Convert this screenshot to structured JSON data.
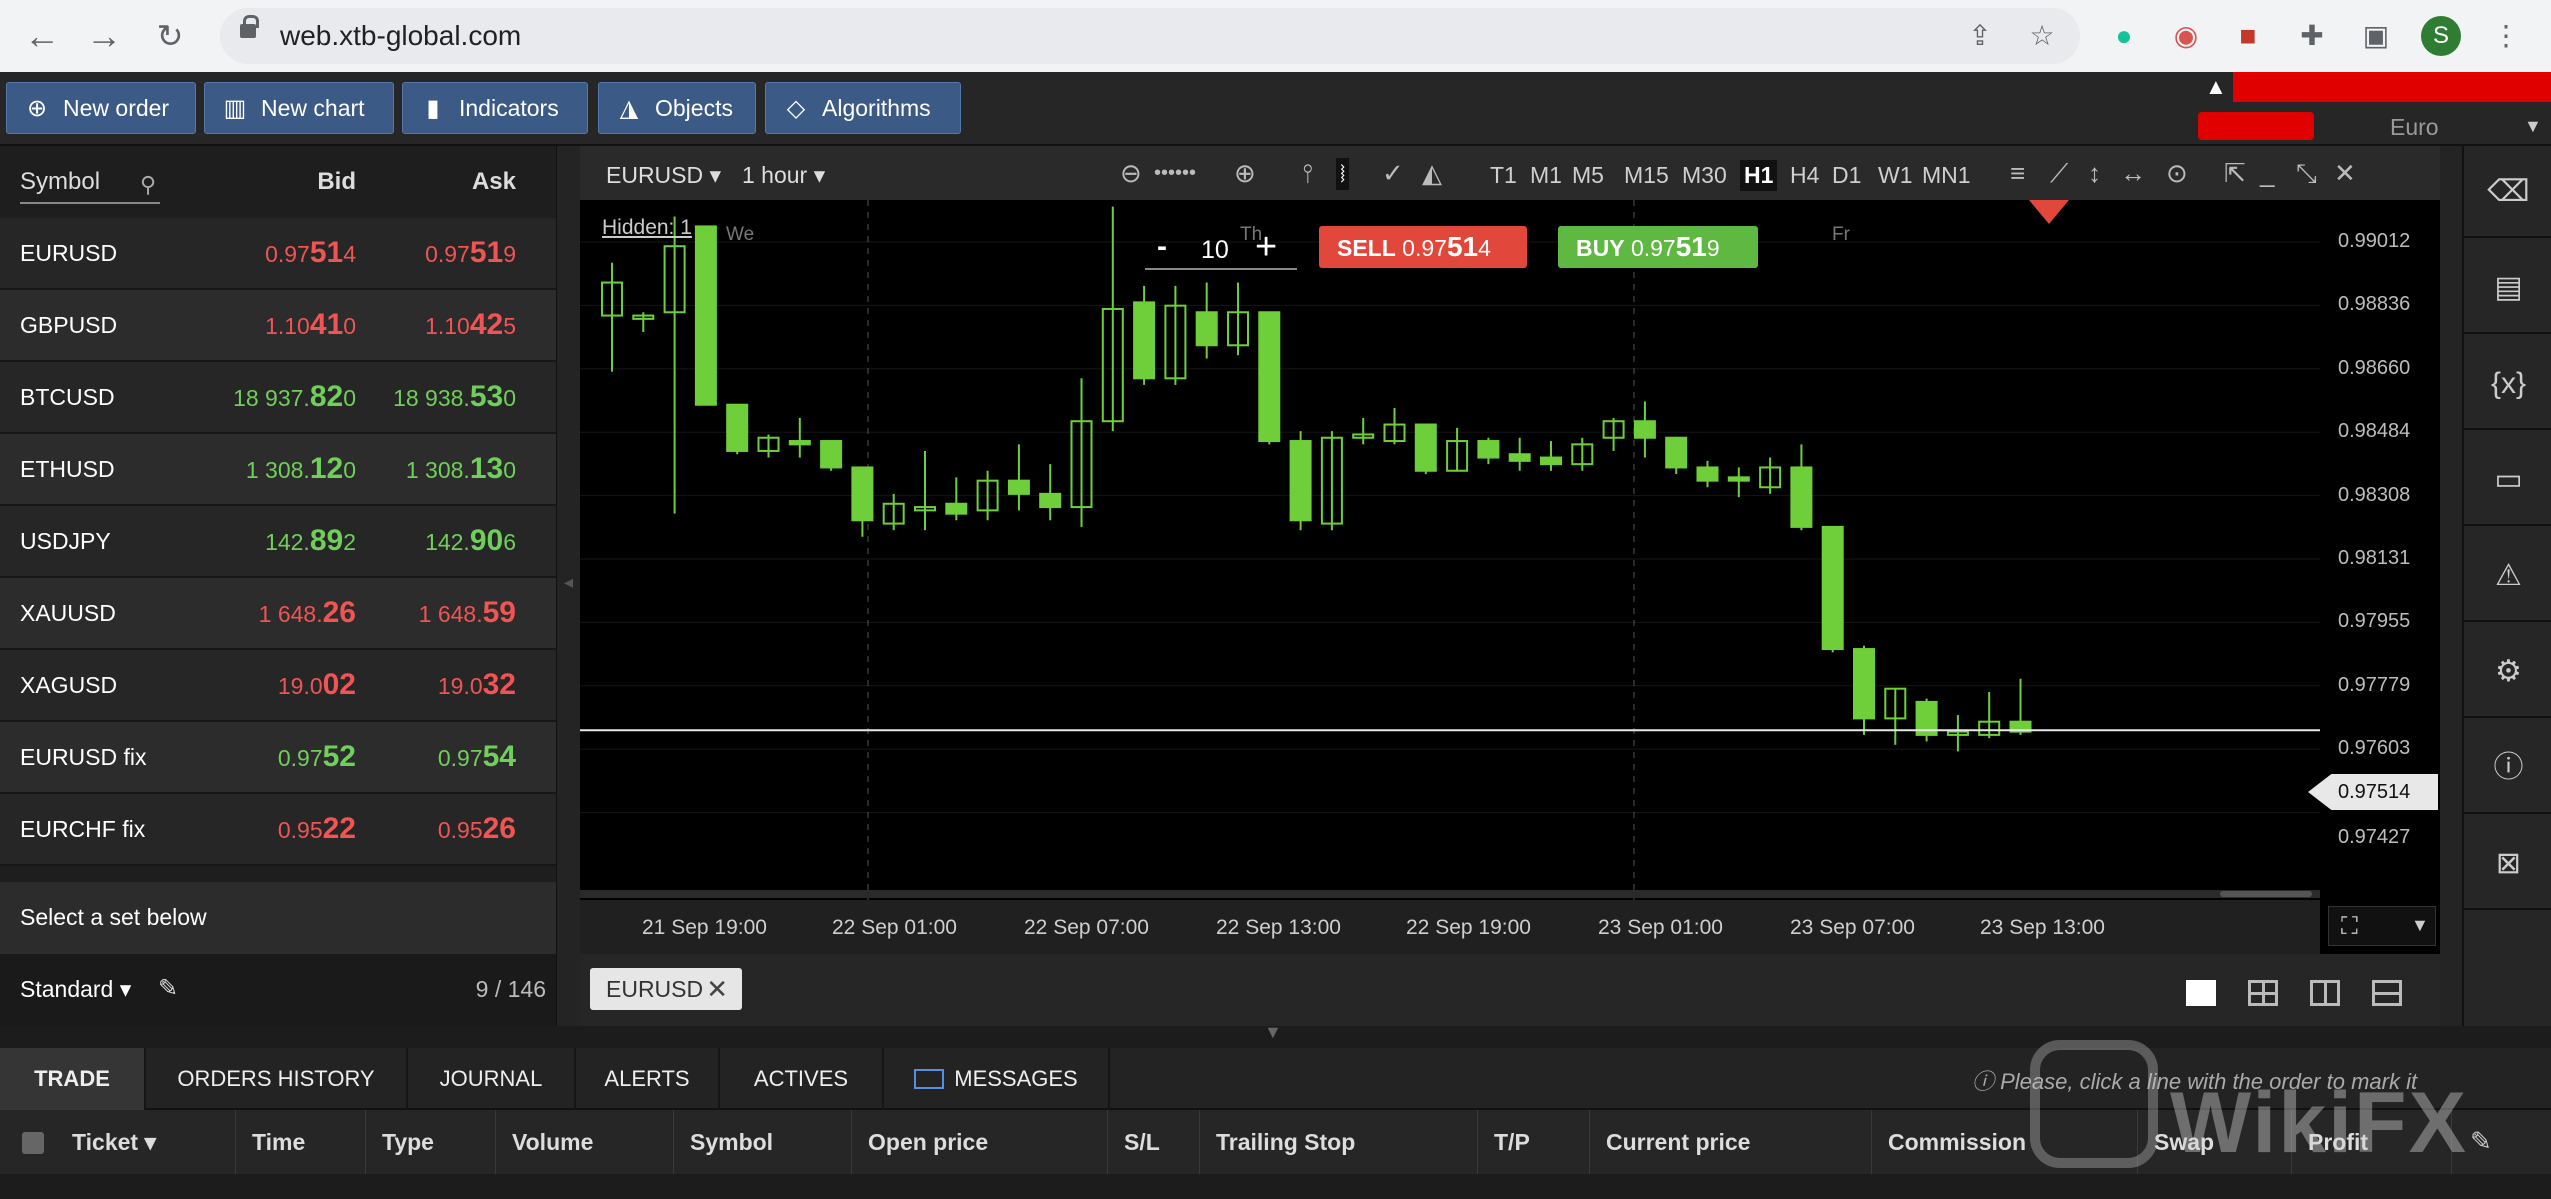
{
  "browser": {
    "url": "web.xtb-global.com",
    "avatar_letter": "S"
  },
  "toolbar": {
    "new_order": "New order",
    "new_chart": "New chart",
    "indicators": "Indicators",
    "objects": "Objects",
    "algorithms": "Algorithms"
  },
  "account": {
    "currency": "Euro"
  },
  "symbols": {
    "header_symbol": "Symbol",
    "header_bid": "Bid",
    "header_ask": "Ask",
    "rows": [
      {
        "name": "EURUSD",
        "bid_a": "0.97",
        "bid_b": "51",
        "bid_c": "4",
        "ask_a": "0.97",
        "ask_b": "51",
        "ask_c": "9",
        "dir": "red"
      },
      {
        "name": "GBPUSD",
        "bid_a": "1.10",
        "bid_b": "41",
        "bid_c": "0",
        "ask_a": "1.10",
        "ask_b": "42",
        "ask_c": "5",
        "dir": "red"
      },
      {
        "name": "BTCUSD",
        "bid_a": "18 937.",
        "bid_b": "82",
        "bid_c": "0",
        "ask_a": "18 938.",
        "ask_b": "53",
        "ask_c": "0",
        "dir": "green"
      },
      {
        "name": "ETHUSD",
        "bid_a": "1 308.",
        "bid_b": "12",
        "bid_c": "0",
        "ask_a": "1 308.",
        "ask_b": "13",
        "ask_c": "0",
        "dir": "green"
      },
      {
        "name": "USDJPY",
        "bid_a": "142.",
        "bid_b": "89",
        "bid_c": "2",
        "ask_a": "142.",
        "ask_b": "90",
        "ask_c": "6",
        "dir": "green"
      },
      {
        "name": "XAUUSD",
        "bid_a": "1 648.",
        "bid_b": "26",
        "bid_c": "",
        "ask_a": "1 648.",
        "ask_b": "59",
        "ask_c": "",
        "dir": "red"
      },
      {
        "name": "XAGUSD",
        "bid_a": "19.0",
        "bid_b": "02",
        "bid_c": "",
        "ask_a": "19.0",
        "ask_b": "32",
        "ask_c": "",
        "dir": "red"
      },
      {
        "name": "EURUSD fix",
        "bid_a": "0.97",
        "bid_b": "52",
        "bid_c": "",
        "ask_a": "0.97",
        "ask_b": "54",
        "ask_c": "",
        "dir": "green"
      },
      {
        "name": "EURCHF fix",
        "bid_a": "0.95",
        "bid_b": "22",
        "bid_c": "",
        "ask_a": "0.95",
        "ask_b": "26",
        "ask_c": "",
        "dir": "red"
      }
    ],
    "select_set": "Select a set below",
    "set_name": "Standard",
    "count": "9 / 146"
  },
  "chart": {
    "symbol": "EURUSD",
    "interval": "1 hour",
    "timeframes": [
      "T1",
      "M1",
      "M5",
      "M15",
      "M30",
      "H1",
      "H4",
      "D1",
      "W1",
      "MN1"
    ],
    "active_timeframe": "H1",
    "hidden": "Hidden: 1",
    "day_labels": [
      "We",
      "Th",
      "Fr"
    ],
    "quantity": "10",
    "sell_label": "SELL",
    "sell_a": "0.97",
    "sell_b": "51",
    "sell_c": "4",
    "buy_label": "BUY",
    "buy_a": "0.97",
    "buy_b": "51",
    "buy_c": "9",
    "price_labels": [
      "0.99012",
      "0.98836",
      "0.98660",
      "0.98484",
      "0.98308",
      "0.98131",
      "0.97955",
      "0.97779",
      "0.97603",
      "0.97427"
    ],
    "current_price": "0.97514",
    "time_labels": [
      "21 Sep 19:00",
      "22 Sep 01:00",
      "22 Sep 07:00",
      "22 Sep 13:00",
      "22 Sep 19:00",
      "23 Sep 01:00",
      "23 Sep 07:00",
      "23 Sep 13:00"
    ],
    "tab": "EURUSD",
    "up_color": "#6fcf3a",
    "down_color": "#6fcf3a"
  },
  "chart_data": {
    "type": "candlestick",
    "y_range": [
      0.97,
      0.9912
    ],
    "current_price": 0.97514,
    "candles": [
      {
        "o": 0.9877,
        "h": 0.9893,
        "l": 0.986,
        "c": 0.9887
      },
      {
        "o": 0.9876,
        "h": 0.9878,
        "l": 0.9872,
        "c": 0.9877
      },
      {
        "o": 0.9878,
        "h": 0.9907,
        "l": 0.9817,
        "c": 0.9898
      },
      {
        "o": 0.9904,
        "h": 0.9904,
        "l": 0.985,
        "c": 0.985
      },
      {
        "o": 0.985,
        "h": 0.985,
        "l": 0.9835,
        "c": 0.9836
      },
      {
        "o": 0.9836,
        "h": 0.9841,
        "l": 0.9834,
        "c": 0.984
      },
      {
        "o": 0.9839,
        "h": 0.9846,
        "l": 0.9834,
        "c": 0.9838
      },
      {
        "o": 0.9839,
        "h": 0.9839,
        "l": 0.983,
        "c": 0.9831
      },
      {
        "o": 0.9831,
        "h": 0.9831,
        "l": 0.981,
        "c": 0.9815
      },
      {
        "o": 0.9814,
        "h": 0.9823,
        "l": 0.9812,
        "c": 0.982
      },
      {
        "o": 0.9818,
        "h": 0.9836,
        "l": 0.9812,
        "c": 0.9819
      },
      {
        "o": 0.982,
        "h": 0.9828,
        "l": 0.9815,
        "c": 0.9817
      },
      {
        "o": 0.9818,
        "h": 0.983,
        "l": 0.9815,
        "c": 0.9827
      },
      {
        "o": 0.9827,
        "h": 0.9838,
        "l": 0.9818,
        "c": 0.9823
      },
      {
        "o": 0.9823,
        "h": 0.9832,
        "l": 0.9815,
        "c": 0.9819
      },
      {
        "o": 0.9819,
        "h": 0.9858,
        "l": 0.9813,
        "c": 0.9845
      },
      {
        "o": 0.9845,
        "h": 0.991,
        "l": 0.9842,
        "c": 0.9879
      },
      {
        "o": 0.9881,
        "h": 0.9886,
        "l": 0.9856,
        "c": 0.9858
      },
      {
        "o": 0.9858,
        "h": 0.9886,
        "l": 0.9856,
        "c": 0.988
      },
      {
        "o": 0.9878,
        "h": 0.9887,
        "l": 0.9864,
        "c": 0.9868
      },
      {
        "o": 0.9868,
        "h": 0.9887,
        "l": 0.9865,
        "c": 0.9878
      },
      {
        "o": 0.9878,
        "h": 0.9878,
        "l": 0.9838,
        "c": 0.9839
      },
      {
        "o": 0.9839,
        "h": 0.9842,
        "l": 0.9812,
        "c": 0.9815
      },
      {
        "o": 0.9814,
        "h": 0.9842,
        "l": 0.9812,
        "c": 0.984
      },
      {
        "o": 0.984,
        "h": 0.9846,
        "l": 0.9838,
        "c": 0.9841
      },
      {
        "o": 0.9839,
        "h": 0.9849,
        "l": 0.9838,
        "c": 0.9844
      },
      {
        "o": 0.9844,
        "h": 0.9844,
        "l": 0.9829,
        "c": 0.983
      },
      {
        "o": 0.983,
        "h": 0.9843,
        "l": 0.983,
        "c": 0.9839
      },
      {
        "o": 0.9839,
        "h": 0.984,
        "l": 0.9832,
        "c": 0.9834
      },
      {
        "o": 0.9835,
        "h": 0.984,
        "l": 0.983,
        "c": 0.9833
      },
      {
        "o": 0.9834,
        "h": 0.9839,
        "l": 0.983,
        "c": 0.9832
      },
      {
        "o": 0.9832,
        "h": 0.984,
        "l": 0.983,
        "c": 0.9838
      },
      {
        "o": 0.984,
        "h": 0.9846,
        "l": 0.9836,
        "c": 0.9845
      },
      {
        "o": 0.9845,
        "h": 0.9851,
        "l": 0.9834,
        "c": 0.984
      },
      {
        "o": 0.984,
        "h": 0.984,
        "l": 0.9829,
        "c": 0.9831
      },
      {
        "o": 0.9831,
        "h": 0.9833,
        "l": 0.9825,
        "c": 0.9827
      },
      {
        "o": 0.9828,
        "h": 0.9831,
        "l": 0.9822,
        "c": 0.9827
      },
      {
        "o": 0.9825,
        "h": 0.9834,
        "l": 0.9823,
        "c": 0.9831
      },
      {
        "o": 0.9831,
        "h": 0.9838,
        "l": 0.9812,
        "c": 0.9813
      },
      {
        "o": 0.9813,
        "h": 0.9813,
        "l": 0.9775,
        "c": 0.9776
      },
      {
        "o": 0.9776,
        "h": 0.9777,
        "l": 0.975,
        "c": 0.9755
      },
      {
        "o": 0.9755,
        "h": 0.9764,
        "l": 0.9747,
        "c": 0.9764
      },
      {
        "o": 0.976,
        "h": 0.9761,
        "l": 0.9748,
        "c": 0.975
      },
      {
        "o": 0.975,
        "h": 0.9756,
        "l": 0.9745,
        "c": 0.9751
      },
      {
        "o": 0.975,
        "h": 0.9763,
        "l": 0.9749,
        "c": 0.9754
      },
      {
        "o": 0.9754,
        "h": 0.9767,
        "l": 0.975,
        "c": 0.9751
      }
    ]
  },
  "bottom": {
    "tabs": [
      "TRADE",
      "ORDERS HISTORY",
      "JOURNAL",
      "ALERTS",
      "ACTIVES",
      "MESSAGES"
    ],
    "hint": "Please, click a line with the order to mark it",
    "columns": [
      "Ticket",
      "Time",
      "Type",
      "Volume",
      "Symbol",
      "Open price",
      "S/L",
      "Trailing Stop",
      "T/P",
      "Current price",
      "Commission",
      "Swap",
      "Profit"
    ]
  },
  "watermark": "WikiFX"
}
